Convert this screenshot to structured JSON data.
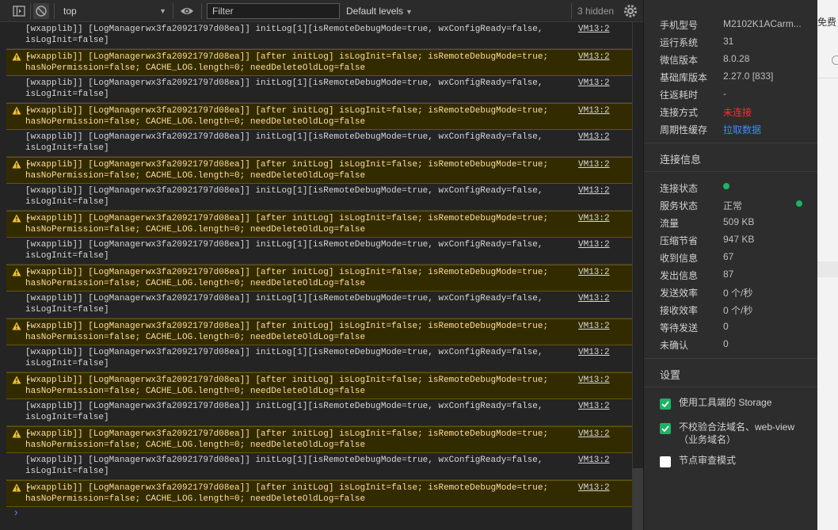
{
  "toolbar": {
    "context": "top",
    "filter_placeholder": "Filter",
    "levels": "Default levels",
    "hidden": "3 hidden"
  },
  "console": {
    "rows": [
      {
        "type": "info",
        "line1": "[wxapplib]] [LogManagerwx3fa20921797d08ea]] initLog[1][isRemoteDebugMode=true, wxConfigReady=false,",
        "line2": "isLogInit=false]",
        "source": "VM13:2"
      },
      {
        "type": "warn",
        "line1": "[wxapplib]] [LogManagerwx3fa20921797d08ea]] [after initLog] isLogInit=false; isRemoteDebugMode=true;",
        "line2": "hasNoPermission=false; CACHE_LOG.length=0; needDeleteOldLog=false",
        "source": "VM13:2"
      },
      {
        "type": "info",
        "line1": "[wxapplib]] [LogManagerwx3fa20921797d08ea]] initLog[1][isRemoteDebugMode=true, wxConfigReady=false,",
        "line2": "isLogInit=false]",
        "source": "VM13:2"
      },
      {
        "type": "warn",
        "line1": "[wxapplib]] [LogManagerwx3fa20921797d08ea]] [after initLog] isLogInit=false; isRemoteDebugMode=true;",
        "line2": "hasNoPermission=false; CACHE_LOG.length=0; needDeleteOldLog=false",
        "source": "VM13:2"
      },
      {
        "type": "info",
        "line1": "[wxapplib]] [LogManagerwx3fa20921797d08ea]] initLog[1][isRemoteDebugMode=true, wxConfigReady=false,",
        "line2": "isLogInit=false]",
        "source": "VM13:2"
      },
      {
        "type": "warn",
        "line1": "[wxapplib]] [LogManagerwx3fa20921797d08ea]] [after initLog] isLogInit=false; isRemoteDebugMode=true;",
        "line2": "hasNoPermission=false; CACHE_LOG.length=0; needDeleteOldLog=false",
        "source": "VM13:2"
      },
      {
        "type": "info",
        "line1": "[wxapplib]] [LogManagerwx3fa20921797d08ea]] initLog[1][isRemoteDebugMode=true, wxConfigReady=false,",
        "line2": "isLogInit=false]",
        "source": "VM13:2"
      },
      {
        "type": "warn",
        "line1": "[wxapplib]] [LogManagerwx3fa20921797d08ea]] [after initLog] isLogInit=false; isRemoteDebugMode=true;",
        "line2": "hasNoPermission=false; CACHE_LOG.length=0; needDeleteOldLog=false",
        "source": "VM13:2"
      },
      {
        "type": "info",
        "line1": "[wxapplib]] [LogManagerwx3fa20921797d08ea]] initLog[1][isRemoteDebugMode=true, wxConfigReady=false,",
        "line2": "isLogInit=false]",
        "source": "VM13:2"
      },
      {
        "type": "warn",
        "line1": "[wxapplib]] [LogManagerwx3fa20921797d08ea]] [after initLog] isLogInit=false; isRemoteDebugMode=true;",
        "line2": "hasNoPermission=false; CACHE_LOG.length=0; needDeleteOldLog=false",
        "source": "VM13:2"
      },
      {
        "type": "info",
        "line1": "[wxapplib]] [LogManagerwx3fa20921797d08ea]] initLog[1][isRemoteDebugMode=true, wxConfigReady=false,",
        "line2": "isLogInit=false]",
        "source": "VM13:2"
      },
      {
        "type": "warn",
        "line1": "[wxapplib]] [LogManagerwx3fa20921797d08ea]] [after initLog] isLogInit=false; isRemoteDebugMode=true;",
        "line2": "hasNoPermission=false; CACHE_LOG.length=0; needDeleteOldLog=false",
        "source": "VM13:2"
      },
      {
        "type": "info",
        "line1": "[wxapplib]] [LogManagerwx3fa20921797d08ea]] initLog[1][isRemoteDebugMode=true, wxConfigReady=false,",
        "line2": "isLogInit=false]",
        "source": "VM13:2"
      },
      {
        "type": "warn",
        "line1": "[wxapplib]] [LogManagerwx3fa20921797d08ea]] [after initLog] isLogInit=false; isRemoteDebugMode=true;",
        "line2": "hasNoPermission=false; CACHE_LOG.length=0; needDeleteOldLog=false",
        "source": "VM13:2"
      },
      {
        "type": "info",
        "line1": "[wxapplib]] [LogManagerwx3fa20921797d08ea]] initLog[1][isRemoteDebugMode=true, wxConfigReady=false,",
        "line2": "isLogInit=false]",
        "source": "VM13:2"
      },
      {
        "type": "warn",
        "line1": "[wxapplib]] [LogManagerwx3fa20921797d08ea]] [after initLog] isLogInit=false; isRemoteDebugMode=true;",
        "line2": "hasNoPermission=false; CACHE_LOG.length=0; needDeleteOldLog=false",
        "source": "VM13:2"
      },
      {
        "type": "info",
        "line1": "[wxapplib]] [LogManagerwx3fa20921797d08ea]] initLog[1][isRemoteDebugMode=true, wxConfigReady=false,",
        "line2": "isLogInit=false]",
        "source": "VM13:2"
      },
      {
        "type": "warn",
        "line1": "[wxapplib]] [LogManagerwx3fa20921797d08ea]] [after initLog] isLogInit=false; isRemoteDebugMode=true;",
        "line2": "hasNoPermission=false; CACHE_LOG.length=0; needDeleteOldLog=false",
        "source": "VM13:2"
      }
    ],
    "prompt": "›"
  },
  "panel": {
    "device": {
      "model_label": "手机型号",
      "model_value": "M2102K1ACarm...",
      "os_label": "运行系统",
      "os_value": "31",
      "wx_label": "微信版本",
      "wx_value": "8.0.28",
      "lib_label": "基础库版本",
      "lib_value": "2.27.0 [833]",
      "rtt_label": "往返耗时",
      "rtt_value": "-",
      "conn_label": "连接方式",
      "conn_value": "未连接",
      "cache_label": "周期性缓存",
      "cache_value": "拉取数据"
    },
    "conn_info": {
      "heading": "连接信息",
      "state_label": "连接状态",
      "service_label": "服务状态",
      "service_value": "正常",
      "traffic_label": "流量",
      "traffic_value": "509 KB",
      "saved_label": "压缩节省",
      "saved_value": "947 KB",
      "recv_label": "收到信息",
      "recv_value": "67",
      "sent_label": "发出信息",
      "sent_value": "87",
      "send_rate_label": "发送效率",
      "send_rate_value": "0 个/秒",
      "recv_rate_label": "接收效率",
      "recv_rate_value": "0 个/秒",
      "wait_label": "等待发送",
      "wait_value": "0",
      "unconfirmed_label": "未确认",
      "unconfirmed_value": "0"
    },
    "settings": {
      "heading": "设置",
      "opt1": "使用工具端的 Storage",
      "opt1_checked": true,
      "opt2": "不校验合法域名、web-view（业务域名）",
      "opt2_checked": true,
      "opt3": "节点审查模式",
      "opt3_checked": false
    },
    "colors": {
      "ok": "#1db366",
      "error": "#ff2b2b",
      "link": "#3b8cff"
    }
  },
  "background": {
    "text": "免费"
  }
}
